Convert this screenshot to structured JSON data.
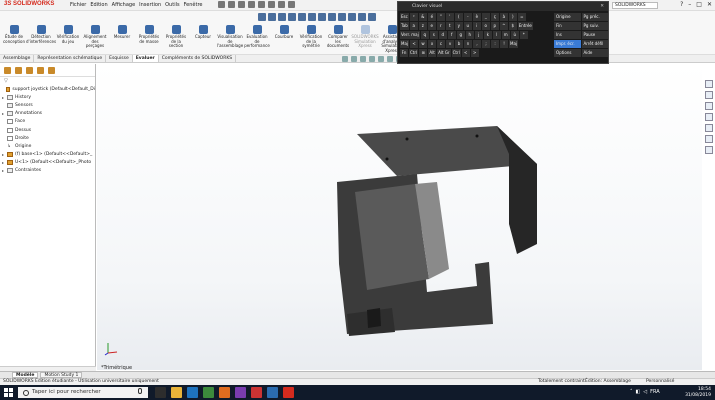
{
  "app": {
    "logo_prefix": "3S",
    "logo_name": "SOLIDWORKS",
    "menu": [
      "Fichier",
      "Edition",
      "Affichage",
      "Insertion",
      "Outils",
      "Fenêtre"
    ],
    "search_placeholder": "SOLIDWORKS",
    "window_buttons": [
      "?",
      "–",
      "□",
      "✕"
    ]
  },
  "command_tools": [
    {
      "label": "Étude de conception",
      "enabled": true
    },
    {
      "label": "Détection d'interférences",
      "enabled": true
    },
    {
      "label": "Vérification du jeu",
      "enabled": true
    },
    {
      "label": "Alignement des perçages",
      "enabled": true
    },
    {
      "label": "Mesurer",
      "enabled": true
    },
    {
      "label": "Propriétés de masse",
      "enabled": true
    },
    {
      "label": "Propriétés de la section",
      "enabled": true
    },
    {
      "label": "Capteur",
      "enabled": true
    },
    {
      "label": "Visualisation de l'assemblage",
      "enabled": true
    },
    {
      "label": "Evaluation de performance",
      "enabled": true
    },
    {
      "label": "Courbure",
      "enabled": true
    },
    {
      "label": "Vérification de la symétrie",
      "enabled": true
    },
    {
      "label": "Comparer les documents",
      "enabled": true
    },
    {
      "label": "SOLIDWORKS Simulation Xpress",
      "enabled": false
    },
    {
      "label": "Assistant d'analyse Simulation Xpress",
      "enabled": true
    }
  ],
  "tabs": [
    {
      "label": "Assemblage",
      "active": false
    },
    {
      "label": "Représentation schématique",
      "active": false
    },
    {
      "label": "Esquisse",
      "active": false
    },
    {
      "label": "Evaluer",
      "active": true
    },
    {
      "label": "Compléments de SOLIDWORKS",
      "active": false
    }
  ],
  "feature_tree": {
    "filter_icon": "filter-icon",
    "items": [
      {
        "label": "support joystick (Default<Default_Di",
        "icon": "assembly",
        "expand": ""
      },
      {
        "label": "History",
        "icon": "folder",
        "expand": "▸"
      },
      {
        "label": "Sensors",
        "icon": "folder",
        "expand": ""
      },
      {
        "label": "Annotations",
        "icon": "folder",
        "expand": "▸"
      },
      {
        "label": "Face",
        "icon": "plane",
        "expand": ""
      },
      {
        "label": "Dessus",
        "icon": "plane",
        "expand": ""
      },
      {
        "label": "Droite",
        "icon": "plane",
        "expand": ""
      },
      {
        "label": "Origine",
        "icon": "origin",
        "expand": ""
      },
      {
        "label": "(f) base<1> (Default<<Default>_",
        "icon": "part",
        "expand": "▸"
      },
      {
        "label": "U<1> (Default<<Default>_Photo",
        "icon": "part",
        "expand": "▸"
      },
      {
        "label": "Contraintes",
        "icon": "folder",
        "expand": "▸"
      }
    ]
  },
  "viewport": {
    "view_name": "*Trimétrique",
    "model_colors": {
      "body_top": "#4a4a4a",
      "body_side": "#2a2a2a",
      "body_front": "#3a3a3a",
      "highlight": "#9a9a9a"
    }
  },
  "bottom_tabs": [
    {
      "label": "Modèle",
      "active": true
    },
    {
      "label": "Motion Study 1",
      "active": false
    }
  ],
  "status": {
    "left": "SOLIDWORKS Edition étudiante - Utilisation universitaire uniquement",
    "state": "Totalement contraint",
    "mode": "Édition: Assemblage",
    "units": "Personnalisé"
  },
  "osk": {
    "title": "Clavier visuel",
    "rows": [
      [
        "Esc",
        "²",
        "&",
        "é",
        "\"",
        "'",
        "(",
        "-",
        "è",
        "_",
        "ç",
        "à",
        ")",
        "="
      ],
      [
        "Tab",
        "a",
        "z",
        "e",
        "r",
        "t",
        "y",
        "u",
        "i",
        "o",
        "p",
        "^",
        "$",
        "Entrée"
      ],
      [
        "Verr. maj",
        "q",
        "s",
        "d",
        "f",
        "g",
        "h",
        "j",
        "k",
        "l",
        "m",
        "ù",
        "*"
      ],
      [
        "Maj",
        "<",
        "w",
        "x",
        "c",
        "v",
        "b",
        "n",
        ",",
        ";",
        ":",
        "!",
        "Maj"
      ],
      [
        "Fn",
        "Ctrl",
        "⊞",
        "Alt",
        "Alt Gr",
        "Ctrl",
        "<",
        ">"
      ]
    ],
    "side_keys": [
      {
        "label": "Origine",
        "hl": false
      },
      {
        "label": "Pg préc.",
        "hl": false
      },
      {
        "label": "Fin",
        "hl": false
      },
      {
        "label": "Pg suiv.",
        "hl": false
      },
      {
        "label": "Ins",
        "hl": false
      },
      {
        "label": "Pause",
        "hl": false
      },
      {
        "label": "Impr. écr.",
        "hl": true
      },
      {
        "label": "Arrêt défil",
        "hl": false
      },
      {
        "label": "Options",
        "hl": false
      },
      {
        "label": "Aide",
        "hl": false
      }
    ]
  },
  "taskbar": {
    "search_placeholder": "Taper ici pour rechercher",
    "lang": "FRA",
    "time": "18:54",
    "date": "31/08/2019",
    "app_colors": [
      "#2d2d2d",
      "#e8b339",
      "#1e73be",
      "#3c8a3c",
      "#e06c1f",
      "#7a3cb0",
      "#c33",
      "#2b6cb0",
      "#d52b1e"
    ]
  }
}
